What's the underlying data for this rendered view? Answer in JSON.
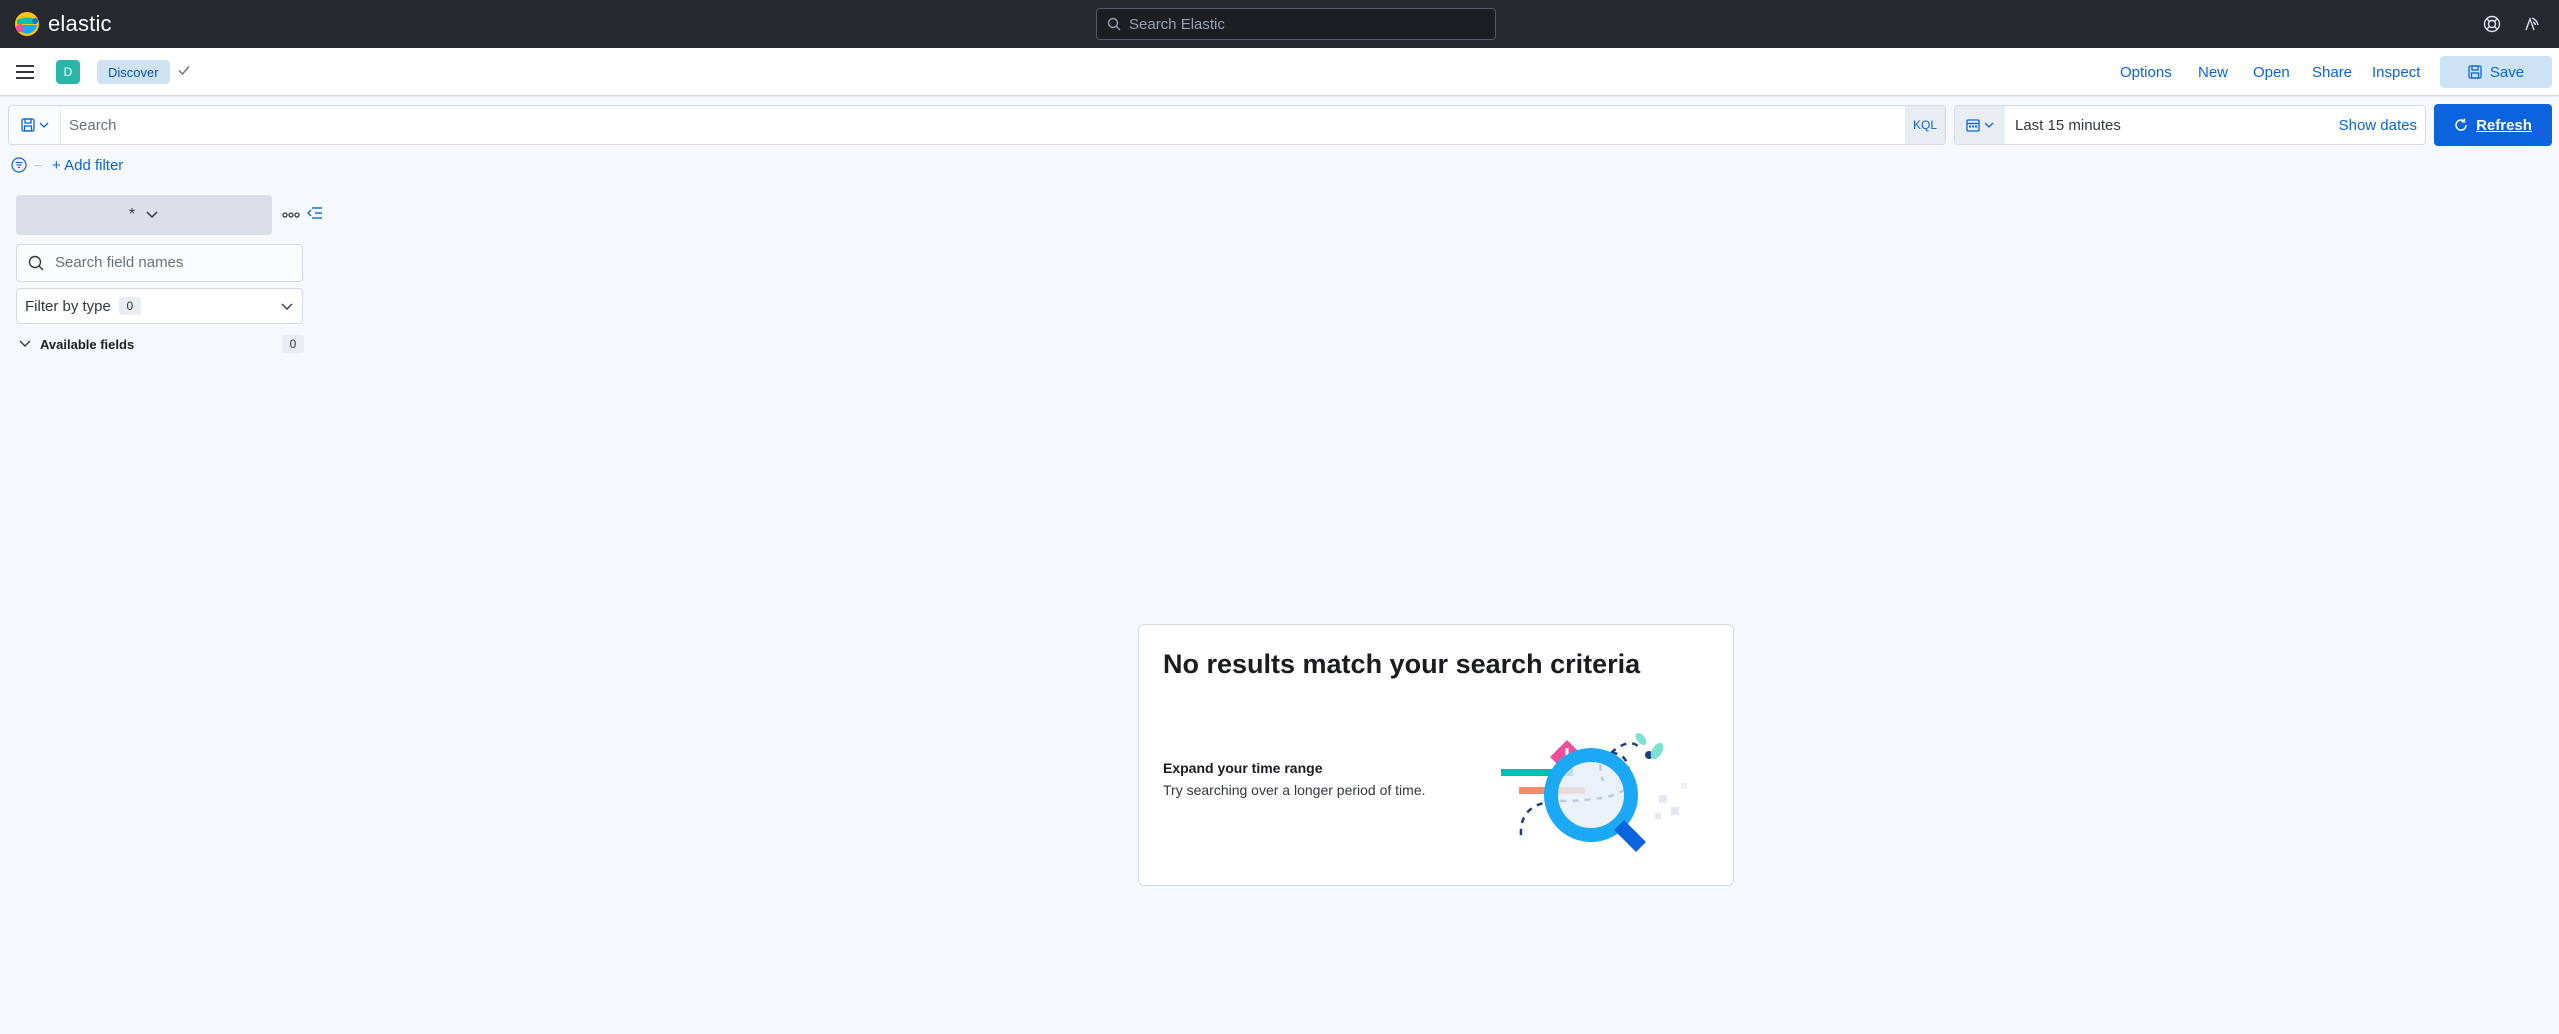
{
  "header": {
    "brand": "elastic",
    "search_placeholder": "Search Elastic",
    "icons": [
      "help-icon",
      "newsfeed-icon"
    ]
  },
  "appbar": {
    "space_initial": "D",
    "breadcrumb": "Discover",
    "nav": [
      "Options",
      "New",
      "Open",
      "Share",
      "Inspect"
    ],
    "save_label": "Save"
  },
  "query": {
    "placeholder": "Search",
    "language": "KQL"
  },
  "date": {
    "value": "Last 15 minutes",
    "show_dates": "Show dates",
    "refresh_label": "Refresh"
  },
  "filters": {
    "add_label": "+ Add filter"
  },
  "sidebar": {
    "index_pattern": "*",
    "field_search_placeholder": "Search field names",
    "filter_by_type_label": "Filter by type",
    "filter_by_type_count": "0",
    "available_fields_label": "Available fields",
    "available_fields_count": "0"
  },
  "empty_state": {
    "title": "No results match your search criteria",
    "subtitle": "Expand your time range",
    "body": "Try searching over a longer period of time."
  },
  "colors": {
    "header_bg": "#25282f",
    "primary": "#0b64dd",
    "space_avatar": "#29b5a8"
  }
}
